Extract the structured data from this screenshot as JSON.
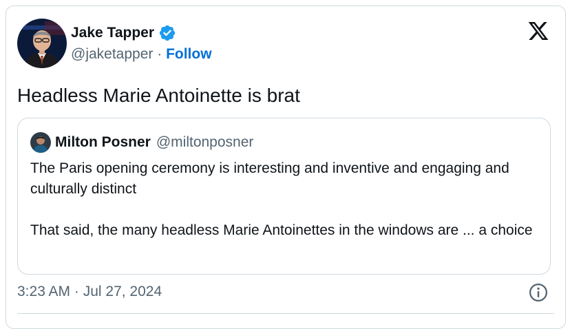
{
  "author": {
    "display_name": "Jake Tapper",
    "handle": "@jaketapper",
    "separator": " · ",
    "follow_label": "Follow",
    "verified": true
  },
  "tweet": {
    "text": "Headless Marie Antoinette is brat",
    "timestamp": "3:23 AM · Jul 27, 2024"
  },
  "quoted_tweet": {
    "display_name": "Milton Posner",
    "handle": "@miltonposner",
    "paragraph_1": "The Paris opening ceremony is interesting and inventive and engaging and culturally distinct",
    "paragraph_2": "That said, the many headless Marie Antoinettes in the windows are ... a choice"
  },
  "icons": {
    "brand": "x-logo-icon",
    "verified": "verified-badge-icon",
    "info": "info-icon"
  },
  "colors": {
    "text": "#0f1419",
    "secondary_text": "#536471",
    "link": "#006fd6",
    "verified_badge": "#1d9bf0",
    "border": "#cfd9de"
  }
}
